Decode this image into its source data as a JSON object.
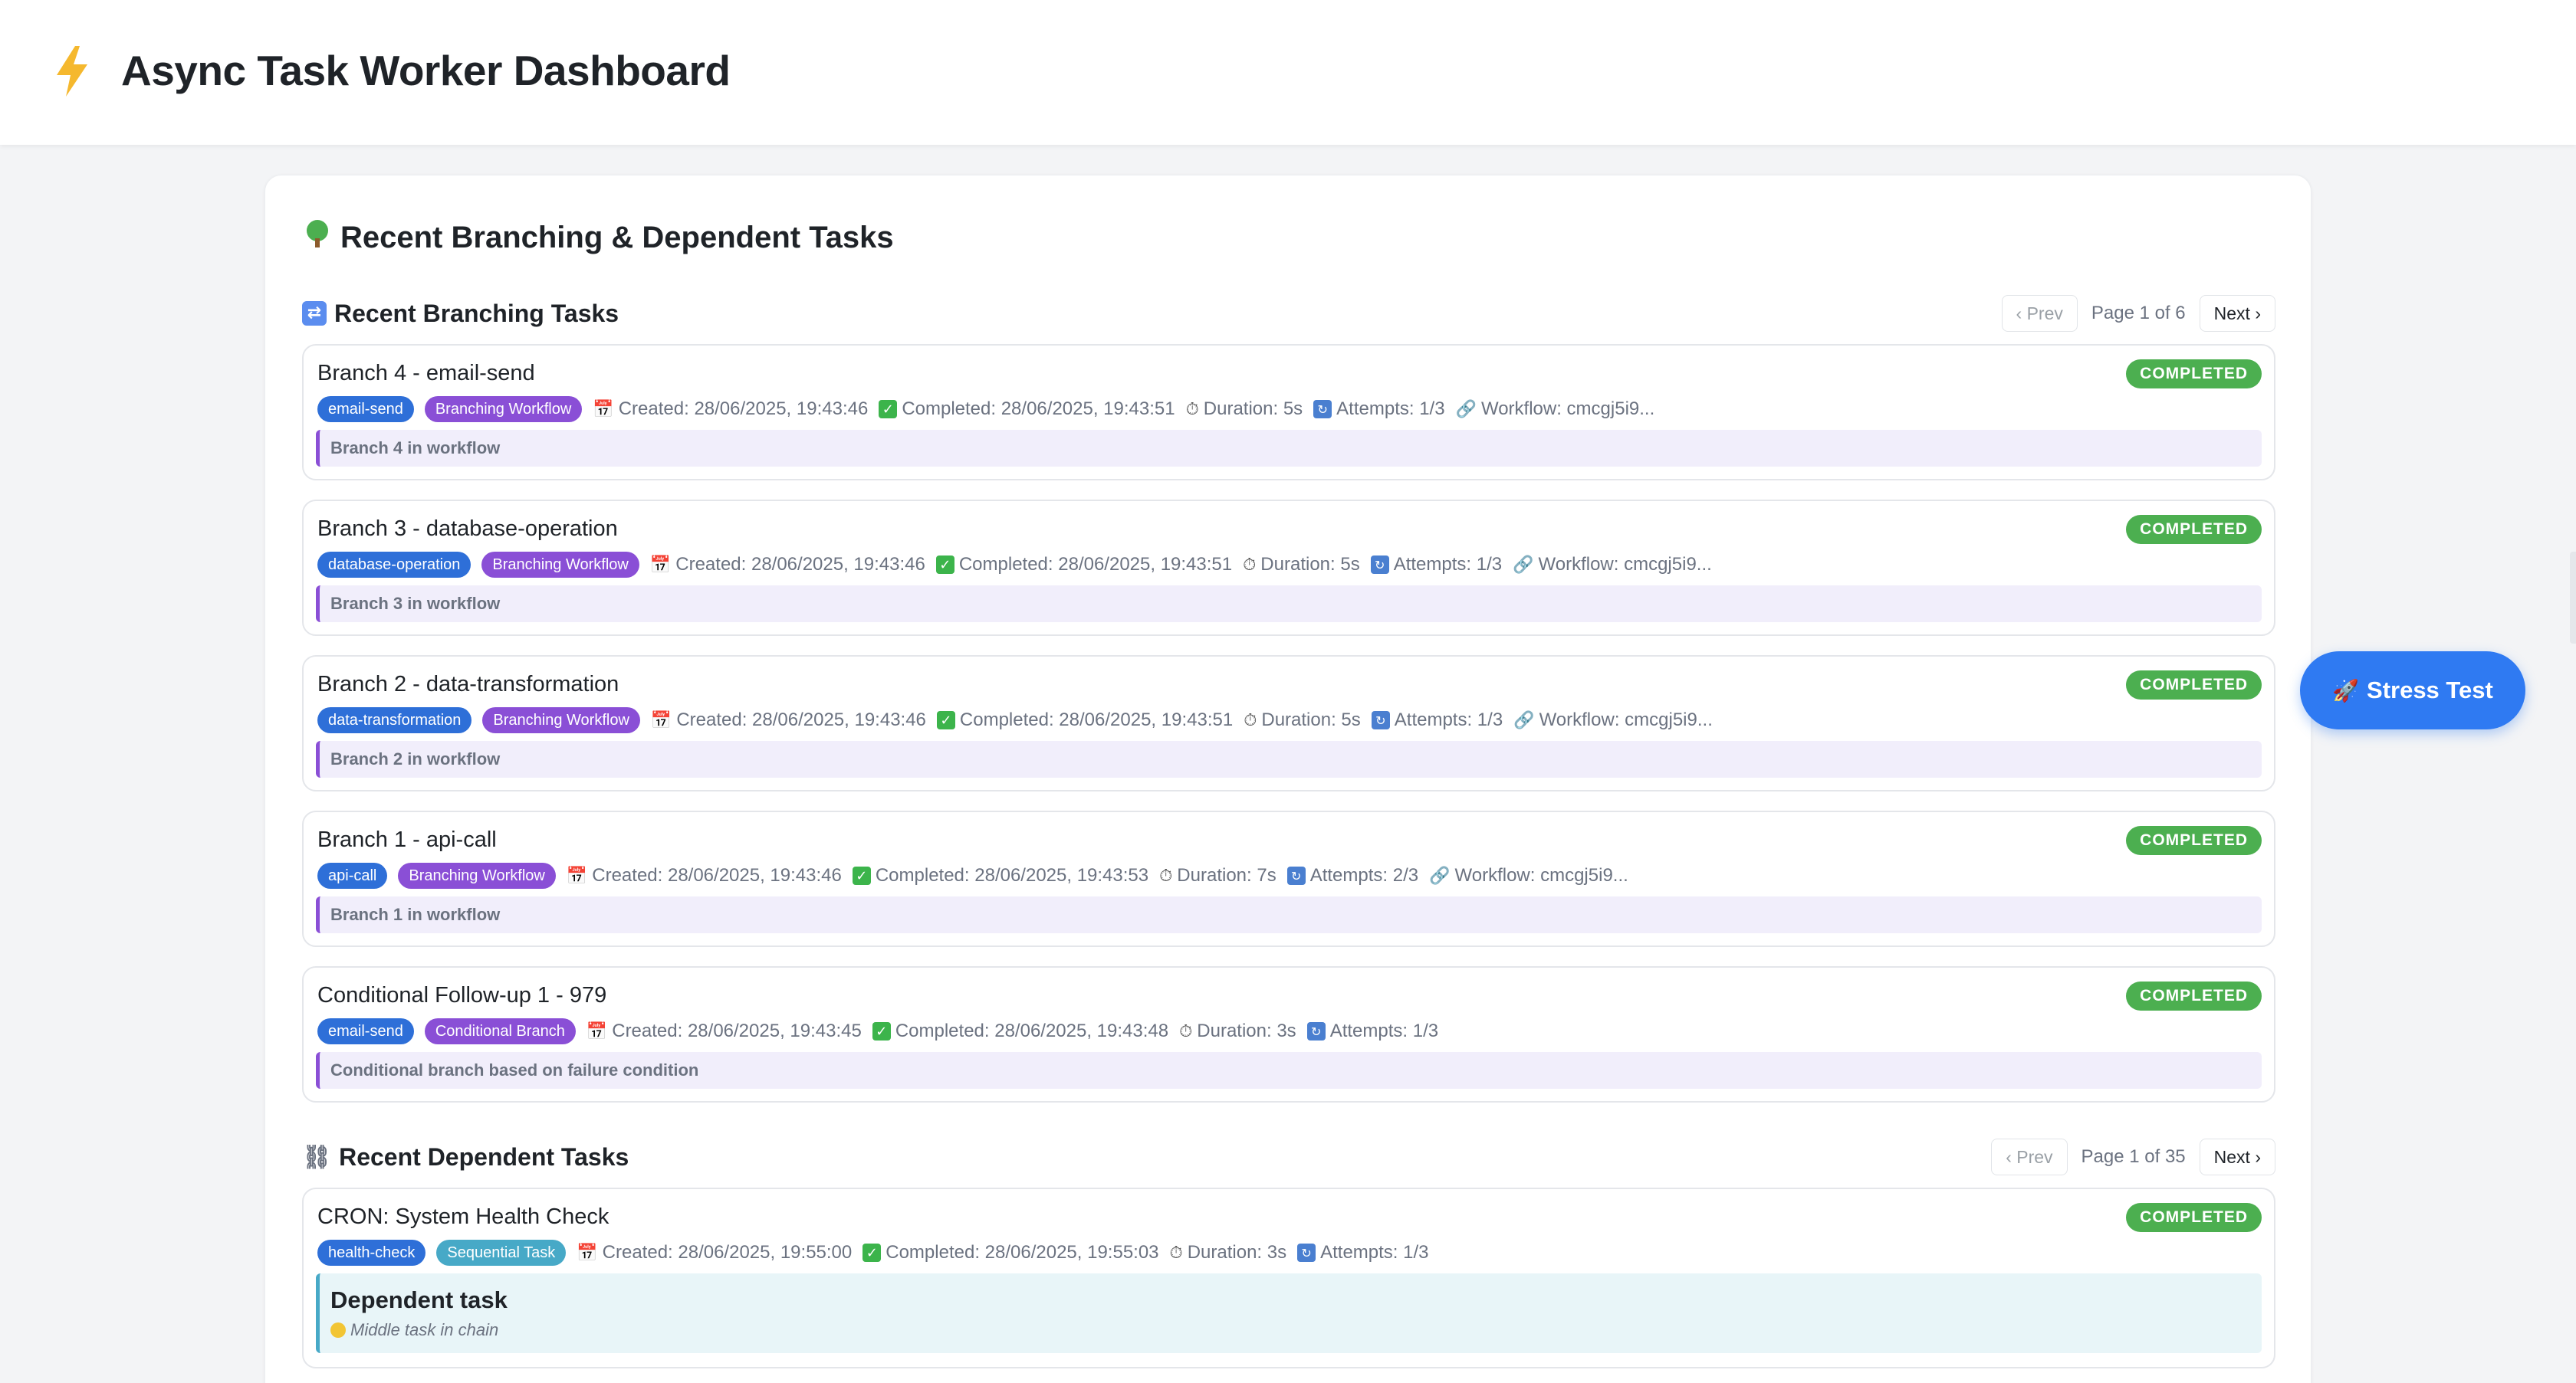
{
  "header": {
    "title": "Async Task Worker Dashboard",
    "logo_icon": "lightning-icon"
  },
  "panel": {
    "title": "Recent Branching & Dependent Tasks",
    "title_icon": "tree-icon"
  },
  "branching": {
    "title": "Recent Branching Tasks",
    "pager": {
      "prev": "‹ Prev",
      "info": "Page 1 of 6",
      "next": "Next ›"
    },
    "tasks": [
      {
        "name": "Branch 4 - email-send",
        "status": "COMPLETED",
        "type": "email-send",
        "workflow_tag": "Branching Workflow",
        "created": "Created: 28/06/2025, 19:43:46",
        "completed": "Completed: 28/06/2025, 19:43:51",
        "duration": "Duration: 5s",
        "attempts": "Attempts: 1/3",
        "workflow": "Workflow: cmcgj5i9...",
        "desc": "Branch 4 in workflow"
      },
      {
        "name": "Branch 3 - database-operation",
        "status": "COMPLETED",
        "type": "database-operation",
        "workflow_tag": "Branching Workflow",
        "created": "Created: 28/06/2025, 19:43:46",
        "completed": "Completed: 28/06/2025, 19:43:51",
        "duration": "Duration: 5s",
        "attempts": "Attempts: 1/3",
        "workflow": "Workflow: cmcgj5i9...",
        "desc": "Branch 3 in workflow"
      },
      {
        "name": "Branch 2 - data-transformation",
        "status": "COMPLETED",
        "type": "data-transformation",
        "workflow_tag": "Branching Workflow",
        "created": "Created: 28/06/2025, 19:43:46",
        "completed": "Completed: 28/06/2025, 19:43:51",
        "duration": "Duration: 5s",
        "attempts": "Attempts: 1/3",
        "workflow": "Workflow: cmcgj5i9...",
        "desc": "Branch 2 in workflow"
      },
      {
        "name": "Branch 1 - api-call",
        "status": "COMPLETED",
        "type": "api-call",
        "workflow_tag": "Branching Workflow",
        "created": "Created: 28/06/2025, 19:43:46",
        "completed": "Completed: 28/06/2025, 19:43:53",
        "duration": "Duration: 7s",
        "attempts": "Attempts: 2/3",
        "workflow": "Workflow: cmcgj5i9...",
        "desc": "Branch 1 in workflow"
      },
      {
        "name": "Conditional Follow-up 1 - 979",
        "status": "COMPLETED",
        "type": "email-send",
        "workflow_tag": "Conditional Branch",
        "created": "Created: 28/06/2025, 19:43:45",
        "completed": "Completed: 28/06/2025, 19:43:48",
        "duration": "Duration: 3s",
        "attempts": "Attempts: 1/3",
        "workflow": "",
        "desc": "Conditional branch based on failure condition"
      }
    ]
  },
  "dependent": {
    "title": "Recent Dependent Tasks",
    "pager": {
      "prev": "‹ Prev",
      "info": "Page 1 of 35",
      "next": "Next ›"
    },
    "tasks": [
      {
        "name": "CRON: System Health Check",
        "status": "COMPLETED",
        "type": "health-check",
        "workflow_tag": "Sequential Task",
        "created": "Created: 28/06/2025, 19:55:00",
        "completed": "Completed: 28/06/2025, 19:55:03",
        "duration": "Duration: 3s",
        "attempts": "Attempts: 1/3",
        "desc_title": "Dependent task",
        "desc_sub": "Middle task in chain"
      }
    ]
  },
  "stress_button": {
    "label": "Stress Test",
    "icon": "rocket-icon"
  },
  "colors": {
    "accent": "#2f7af2",
    "status_completed": "#4caf50",
    "workflow_tag": "#8a4fd6",
    "type_tag": "#2e6fd8",
    "sequential_tag": "#47a9c7"
  }
}
